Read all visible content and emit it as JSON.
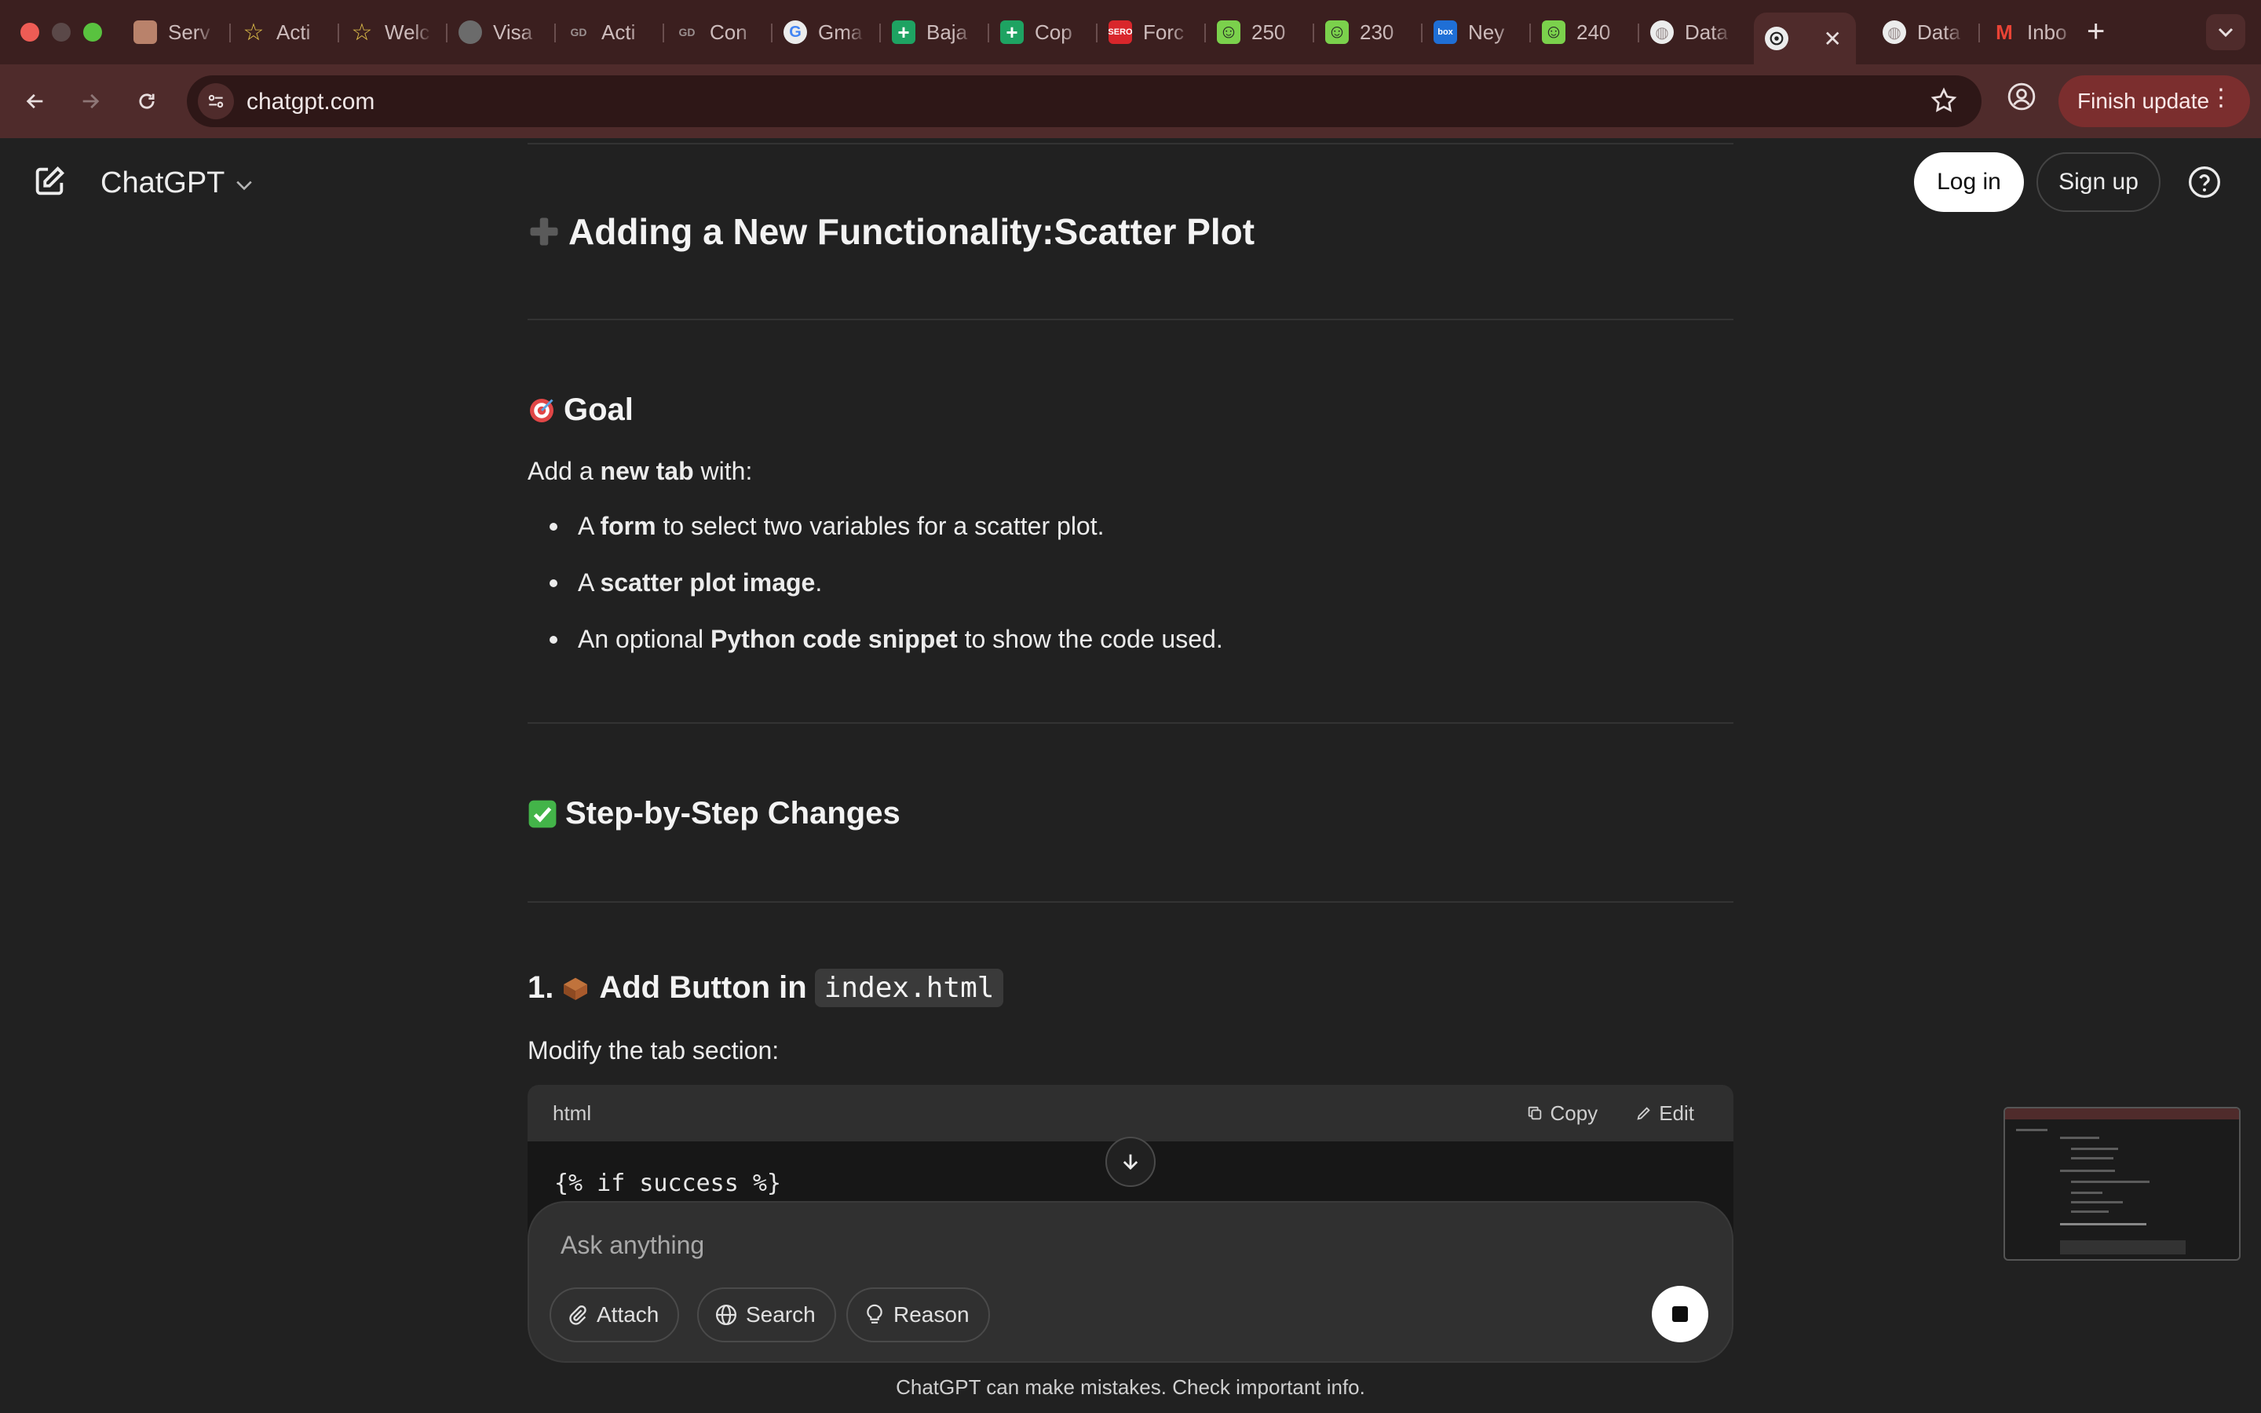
{
  "browser": {
    "tabs": [
      {
        "label": "Serv",
        "favicon": "doc-favicon",
        "color": "#b9826b"
      },
      {
        "label": "Acti",
        "favicon": "star-favicon",
        "color": "#e2c24a"
      },
      {
        "label": "Welc",
        "favicon": "star-favicon",
        "color": "#e2c24a"
      },
      {
        "label": "Visa",
        "favicon": "seal-favicon",
        "color": "#8a8a8a"
      },
      {
        "label": "Acti",
        "favicon": "gd-favicon",
        "color": "#9a8f8f"
      },
      {
        "label": "Con",
        "favicon": "gd-favicon",
        "color": "#9a8f8f"
      },
      {
        "label": "Gma",
        "favicon": "google-favicon",
        "color": "#4285f4"
      },
      {
        "label": "Baja",
        "favicon": "sheets-plus-favicon",
        "color": "#1ea362"
      },
      {
        "label": "Cop",
        "favicon": "sheets-plus-favicon",
        "color": "#1ea362"
      },
      {
        "label": "Forc",
        "favicon": "red-logo-favicon",
        "color": "#d9262b"
      },
      {
        "label": "250",
        "favicon": "smiley-favicon",
        "color": "#7bd14c"
      },
      {
        "label": "230",
        "favicon": "smiley-favicon",
        "color": "#7bd14c"
      },
      {
        "label": "Ney",
        "favicon": "box-favicon",
        "color": "#1f6fd6"
      },
      {
        "label": "240",
        "favicon": "smiley-favicon",
        "color": "#7bd14c"
      },
      {
        "label": "Data",
        "favicon": "globe-favicon",
        "color": "#9a8f8f"
      }
    ],
    "active_tab_favicon": "openai-favicon",
    "after_tabs": [
      {
        "label": "Data",
        "favicon": "globe-favicon",
        "color": "#9a8f8f"
      },
      {
        "label": "Inbo",
        "favicon": "gmail-favicon",
        "color": "#ea4335"
      }
    ],
    "url": "chatgpt.com",
    "finish_update": "Finish update",
    "box_favicon_text": "box",
    "red_favicon_text": "SERO"
  },
  "app": {
    "brand": "ChatGPT",
    "login": "Log in",
    "signup": "Sign up"
  },
  "content": {
    "section_title_prefix": "Adding a New Functionality: ",
    "section_title_bold": "Scatter Plot",
    "goal_heading": "Goal",
    "goal_intro": {
      "pre": "Add a ",
      "bold": "new tab",
      "post": " with:"
    },
    "bullets": [
      {
        "pre": "A ",
        "bold": "form",
        "post": " to select two variables for a scatter plot."
      },
      {
        "pre": "A ",
        "bold": "scatter plot image",
        "post": "."
      },
      {
        "pre": "An optional ",
        "bold": "Python code snippet",
        "post": " to show the code used."
      }
    ],
    "steps_heading": "Step-by-Step Changes",
    "step1_prefix": "1.",
    "step1_title": "Add Button in",
    "step1_code": "index.html",
    "step1_desc": "Modify the tab section:",
    "code_lang": "html",
    "copy": "Copy",
    "edit": "Edit",
    "code_line": "{% if success %}"
  },
  "composer": {
    "placeholder": "Ask anything",
    "attach": "Attach",
    "search": "Search",
    "reason": "Reason"
  },
  "disclaimer": "ChatGPT can make mistakes. Check important info."
}
